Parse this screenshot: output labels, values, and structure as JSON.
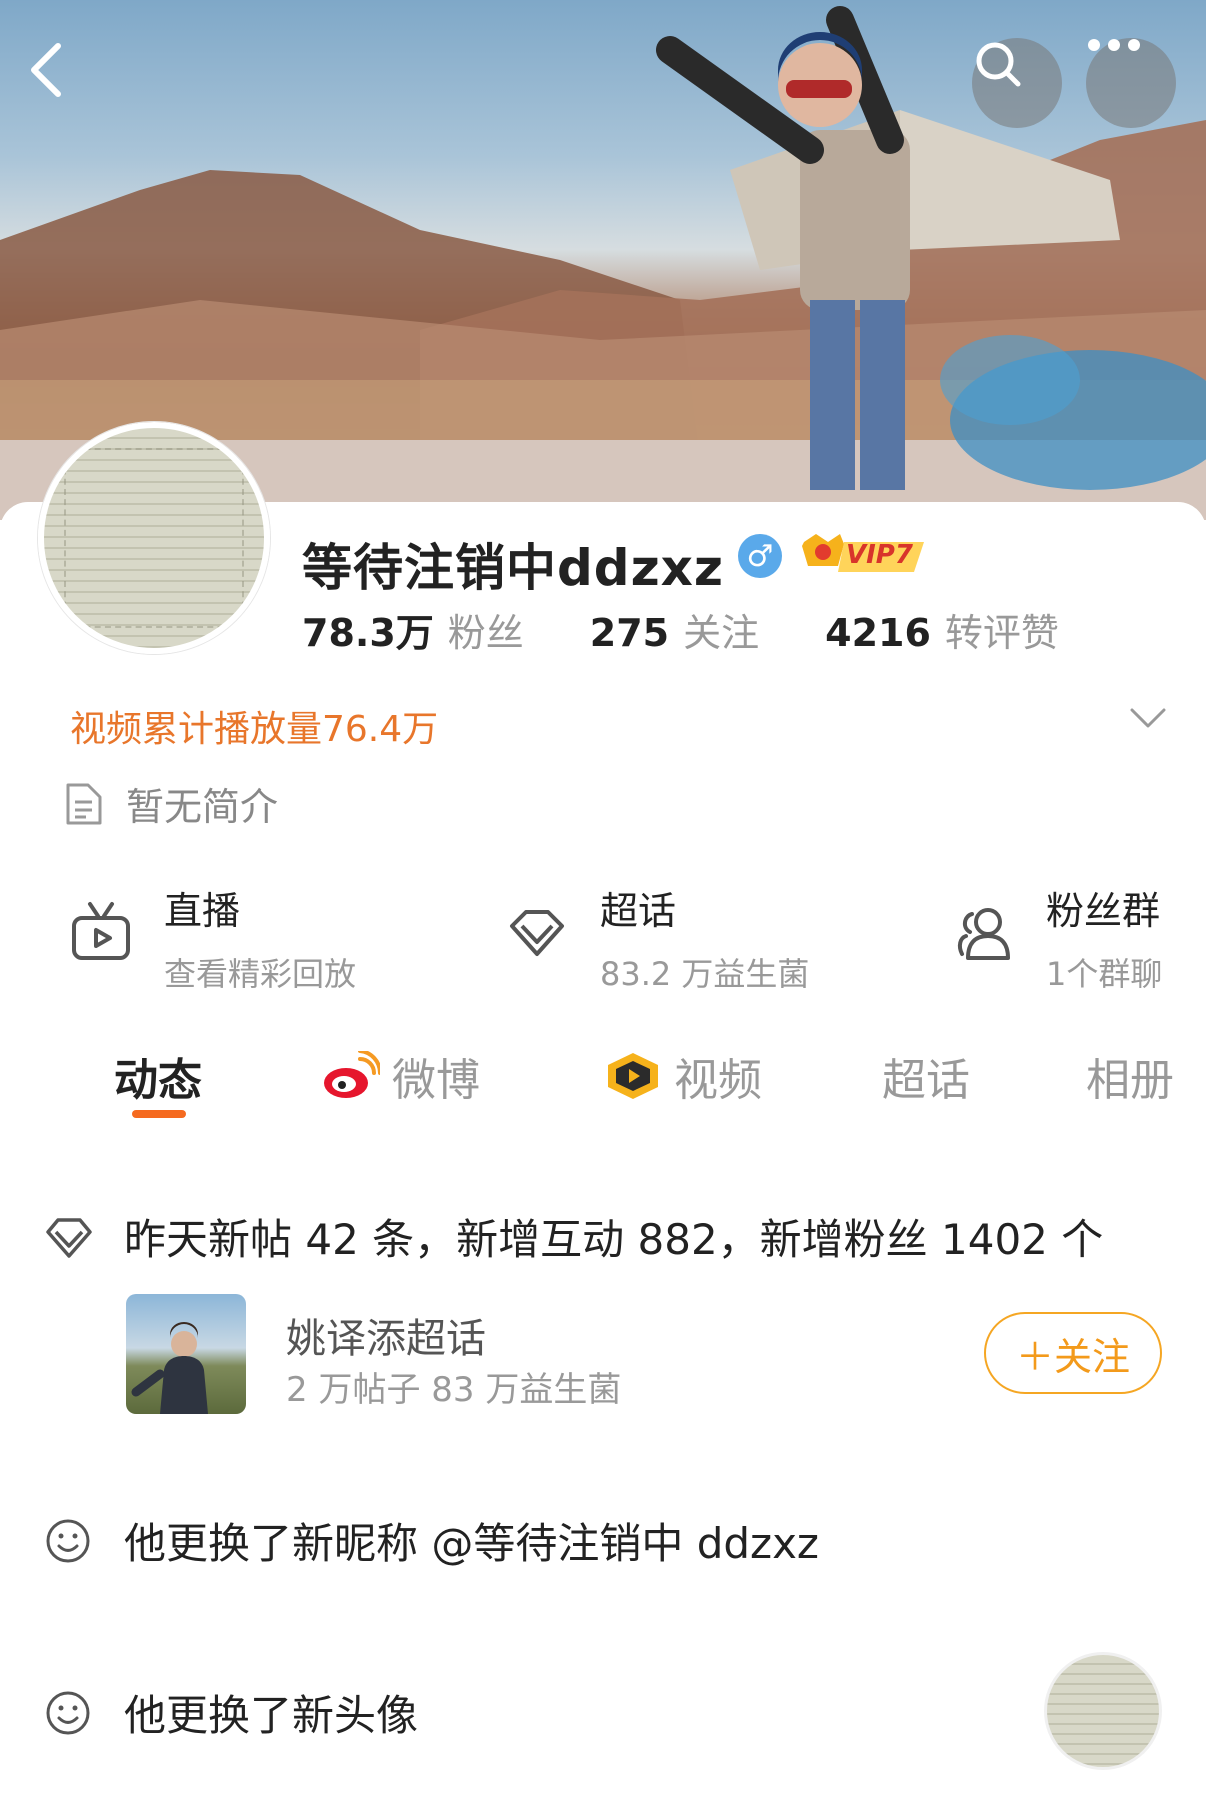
{
  "profile": {
    "nickname": "等待注销中ddzxz",
    "gender_symbol": "♂",
    "vip_badge": "VIP7",
    "stats": [
      {
        "num": "78.3万",
        "label": "粉丝"
      },
      {
        "num": "275",
        "label": "关注"
      },
      {
        "num": "4216",
        "label": "转评赞"
      }
    ],
    "play_count": "视频累计播放量76.4万",
    "intro": "暂无简介"
  },
  "shortcuts": [
    {
      "title": "直播",
      "sub": "查看精彩回放",
      "icon": "tv-icon"
    },
    {
      "title": "超话",
      "sub": "83.2 万益生菌",
      "icon": "diamond-icon"
    },
    {
      "title": "粉丝群",
      "sub": "1个群聊",
      "icon": "group-icon"
    }
  ],
  "tabs": [
    {
      "label": "动态",
      "active": true
    },
    {
      "label": "微博",
      "icon": "weibo-logo-icon"
    },
    {
      "label": "视频",
      "icon": "video-play-icon"
    },
    {
      "label": "超话"
    },
    {
      "label": "相册"
    }
  ],
  "feed": {
    "summary": "昨天新帖 42 条，新增互动 882，新增粉丝 1402 个",
    "topic": {
      "name": "姚译添超话",
      "meta": "2 万帖子 83 万益生菌",
      "follow_label": "＋关注"
    },
    "nickname_change": "他更换了新昵称 @等待注销中 ddzxz",
    "avatar_change": "他更换了新头像"
  },
  "colors": {
    "accent": "#f56a1f",
    "play_count": "#e8762b",
    "follow_border": "#f5a623"
  }
}
